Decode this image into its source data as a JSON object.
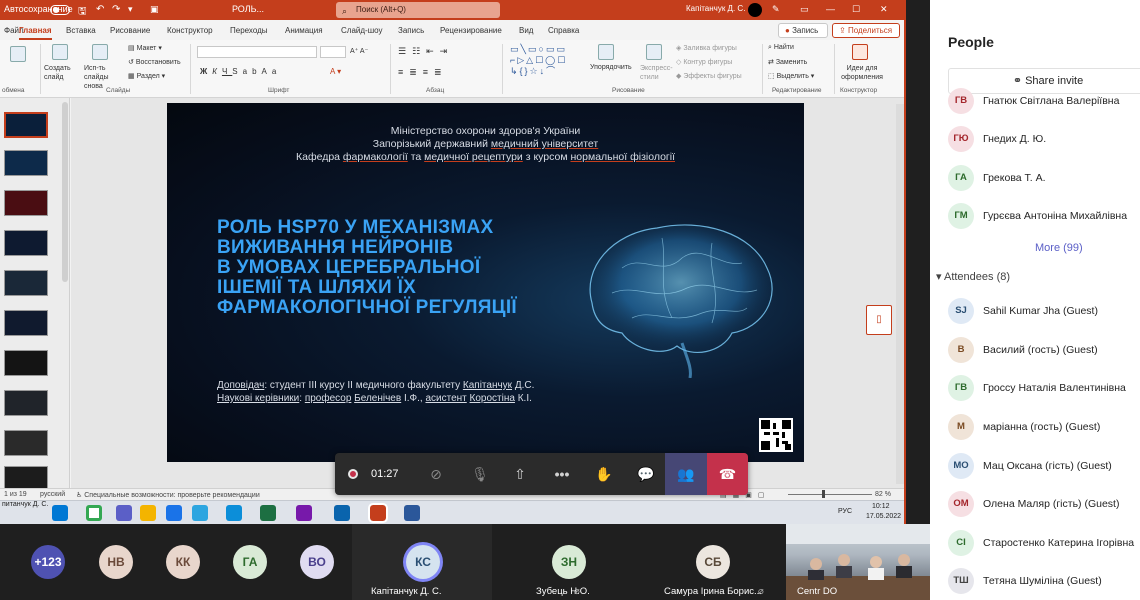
{
  "colors": {
    "ppt_accent": "#c43e1c",
    "teams_accent": "#5b5fc7",
    "slide_title": "#3aa3f5",
    "hangup": "#c4314b"
  },
  "ppt": {
    "titlebar": {
      "autosave": "Автосохранение",
      "doc_title": "РОЛЬ...",
      "search": "Поиск (Alt+Q)",
      "user": "Капітанчук Д. С."
    },
    "tabs": [
      "Файл",
      "Главная",
      "Вставка",
      "Рисование",
      "Конструктор",
      "Переходы",
      "Анимация",
      "Слайд-шоу",
      "Запись",
      "Рецензирование",
      "Вид",
      "Справка"
    ],
    "active_tab": "Главная",
    "record_btn": "Запись",
    "share_btn": "Поделиться",
    "ribbon": {
      "create_slide": "Создать слайд",
      "reuse_slides": "Исп-ть слайды снова",
      "layout": "Макет",
      "restore": "Восстановить",
      "section": "Раздел",
      "arrange": "Упорядочить",
      "quick_styles": "Экспресс-стили",
      "shape_fill": "Заливка фигуры",
      "shape_outline": "Контур фигуры",
      "shape_effects": "Эффекты фигуры",
      "find": "Найти",
      "replace": "Заменить",
      "select": "Выделить",
      "design_ideas": "Идеи для оформления",
      "groups": {
        "clipboard": "обмена",
        "slides": "Слайды",
        "font": "Шрифт",
        "paragraph": "Абзац",
        "drawing": "Рисование",
        "editing": "Редактирование",
        "designer": "Конструктор"
      }
    },
    "slide": {
      "header": {
        "line1": "Міністерство охорони здоров'я України",
        "line2_a": "Запорізький державний ",
        "line2_b": "медичний університет",
        "line3_a": "Кафедра ",
        "line3_b": "фармакології",
        "line3_c": " та ",
        "line3_d": "медичної рецептури",
        "line3_e": " з курсом ",
        "line3_f": "нормальної фізіології"
      },
      "title": [
        "РОЛЬ HSP70 У МЕХАНІЗМАХ",
        "ВИЖИВАННЯ НЕЙРОНІВ",
        "В УМОВАХ ЦЕРЕБРАЛЬНОЇ",
        "ІШЕМІЇ ТА ШЛЯХИ ЇХ",
        "ФАРМАКОЛОГІЧНОЇ РЕГУЛЯЦІЇ"
      ],
      "footer1_a": "Доповідач",
      "footer1_b": ": студент ІІІ курсу ІІ медичного факультету ",
      "footer1_c": "Капітанчук",
      "footer1_d": " Д.С.",
      "footer2_a": "Наукові керівники",
      "footer2_b": ": ",
      "footer2_c": "професор",
      "footer2_d": " ",
      "footer2_e": "Беленічев",
      "footer2_f": " І.Ф., ",
      "footer2_g": "асистент",
      "footer2_h": " ",
      "footer2_i": "Коростіна",
      "footer2_j": " К.І."
    },
    "status": {
      "slide_of": "1 из 19",
      "lang": "русский",
      "accessibility": "Специальные возможности: проверьте рекомендации",
      "zoom": "82 %"
    },
    "taskbar": {
      "clock_time": "10:12",
      "clock_date": "17.05.2022",
      "lang": "РУС",
      "user_label": "питанчук Д. С."
    }
  },
  "meeting": {
    "timer": "01:27",
    "controls": [
      "camera-off",
      "mic-off",
      "share-screen",
      "more",
      "raise-hand",
      "chat",
      "people",
      "leave"
    ],
    "gallery": [
      {
        "initials": "+123",
        "color": "#4f52b2",
        "fg": "#ffffff"
      },
      {
        "initials": "НВ",
        "color": "#e8d6cc",
        "fg": "#6b4a3a"
      },
      {
        "initials": "КК",
        "color": "#e8d6cc",
        "fg": "#6b4a3a"
      },
      {
        "initials": "ГА",
        "color": "#d9ead6",
        "fg": "#2d6b2d"
      },
      {
        "initials": "ВО",
        "color": "#e0dcf1",
        "fg": "#4a3f8c"
      },
      {
        "initials": "КС",
        "color": "#d5e3ef",
        "fg": "#2b4f73",
        "name": "Капітанчук Д. С."
      },
      {
        "initials": "ЗН",
        "color": "#d9ead6",
        "fg": "#2d6b2d",
        "name": "Зубець Н.О."
      },
      {
        "initials": "СБ",
        "color": "#ece6df",
        "fg": "#5a4a3a",
        "name": "Самура Ірина Борис..."
      }
    ],
    "camera_label": "Centr DO"
  },
  "people": {
    "title": "People",
    "share_invite": "Share invite",
    "presenters": [
      {
        "initials": "ГВ",
        "name": "Гнатюк Світлана Валеріївна",
        "color": "#f6dfe3",
        "fg": "#a4262c"
      },
      {
        "initials": "ГЮ",
        "name": "Гнедих Д. Ю.",
        "color": "#f6dfe3",
        "fg": "#a4262c"
      },
      {
        "initials": "ГА",
        "name": "Грекова Т. А.",
        "color": "#dff2e4",
        "fg": "#2d6b2d"
      },
      {
        "initials": "ГМ",
        "name": "Гурєєва Антоніна Михайлівна",
        "color": "#dff2e4",
        "fg": "#2d6b2d"
      }
    ],
    "more": "More (99)",
    "attendees_label": "Attendees (8)",
    "attendees": [
      {
        "initials": "SJ",
        "name": "Sahil Kumar Jha (Guest)",
        "color": "#dfe9f5",
        "fg": "#2b4f73"
      },
      {
        "initials": "В",
        "name": "Василий (гость) (Guest)",
        "color": "#f0e4d8",
        "fg": "#7a4a22"
      },
      {
        "initials": "ГВ",
        "name": "Гроссу Наталія Валентинівна",
        "color": "#dff2e4",
        "fg": "#2d6b2d"
      },
      {
        "initials": "М",
        "name": "маріанна (гость) (Guest)",
        "color": "#f0e4d8",
        "fg": "#7a4a22"
      },
      {
        "initials": "МО",
        "name": "Мац Оксана (гість) (Guest)",
        "color": "#dfe9f5",
        "fg": "#2b4f73"
      },
      {
        "initials": "ОМ",
        "name": "Олена Маляр (гість) (Guest)",
        "color": "#f6dfe3",
        "fg": "#a4262c"
      },
      {
        "initials": "СІ",
        "name": "Старостенко Катерина Ігорівна",
        "color": "#dff2e4",
        "fg": "#2d6b2d"
      },
      {
        "initials": "ТШ",
        "name": "Тетяна Шуміліна (Guest)",
        "color": "#e6e6ec",
        "fg": "#444"
      }
    ]
  }
}
